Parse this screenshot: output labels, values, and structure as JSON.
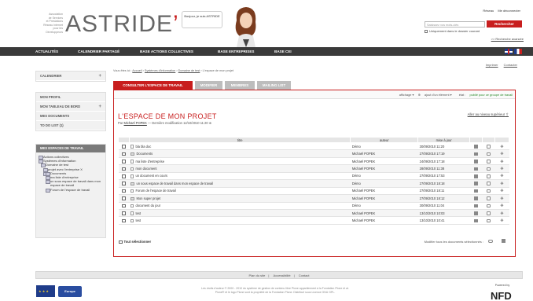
{
  "header": {
    "logo_small_lines": [
      "Association",
      "de Services",
      "et Prestations",
      "Réseau Internet",
      "pour les",
      "Développeurs"
    ],
    "logo_text": "ASTRIDE",
    "bubble_text": "Bonjour, je suis ASTRIDE",
    "links": [
      "Réseau",
      "Me déconnecter"
    ],
    "search_placeholder": "Saisissez vos mots-clés",
    "search_button": "Rechercher",
    "search_checkbox_label": "Uniquement dans le dossier courant",
    "advanced_search": ">> Recherche avancée"
  },
  "topnav": {
    "items": [
      "ACTUALITÉS",
      "CALENDRIER PARTAGÉ",
      "BASE ACTIONS COLLECTIVES",
      "BASE ENTREPRISES",
      "BASE CEI"
    ]
  },
  "sidebar": {
    "top": [
      {
        "label": "CALENDRIER",
        "plus": "+"
      }
    ],
    "menu": [
      {
        "label": "MON PROFIL",
        "plus": ""
      },
      {
        "label": "MON TABLEAU DE BORD",
        "plus": "+"
      },
      {
        "label": "MES DOCUMENTS",
        "plus": ""
      },
      {
        "label": "TO DO LIST (1)",
        "plus": ""
      }
    ],
    "tree_title": "MES ESPACES DE TRAVAIL",
    "tree": [
      "Actions collectives",
      "Systèmes d'information",
      "Domaine de test",
      "projet avec l'entreprise X",
      "",
      "Documents",
      "ma liste d'entreprise",
      "un sous espace de travail dans mon espace de travail",
      "Forum de l'espace de travail"
    ]
  },
  "main": {
    "breadcrumb": [
      "Vous êtes ici :",
      "Accueil",
      "Systèmes d'information",
      "Domaine de test",
      "L'espace de mon projet"
    ],
    "tools": [
      "Imprimer",
      "Contacter"
    ],
    "tabs": [
      "CONSULTER L'ESPACE DE TRAVAIL",
      "MODIFIER",
      "MEMBRES",
      "MAILING LIST"
    ],
    "panel_actions": {
      "display": "affichage",
      "add": "ajout d'un élément",
      "state_label": "état :",
      "state_value": "publié pour ce groupe de travail"
    },
    "title": "L'ESPACE DE MON PROJET",
    "subtitle_prefix": "Par",
    "author": "Michaël POPEK",
    "subtitle_suffix": "— Dernière modification 12/10/2010 11:20",
    "up_link": "Aller au niveau supérieur",
    "columns": [
      "titre",
      "auteur",
      "mise à jour"
    ],
    "rows": [
      {
        "title": "bla bla doc",
        "author": "Démo",
        "date": "30/09/2010 11:20",
        "icon": "file"
      },
      {
        "title": "Documents",
        "author": "Michaël POPEK",
        "date": "27/09/2010 17:19",
        "icon": "folder"
      },
      {
        "title": "ma liste d'entreprise",
        "author": "Michaël POPEK",
        "date": "24/09/2010 17:18",
        "icon": "file"
      },
      {
        "title": "mon document",
        "author": "Michaël POPEK",
        "date": "28/09/2010 11:38",
        "icon": "file"
      },
      {
        "title": "un document en cours",
        "author": "Démo",
        "date": "27/09/2010 17:53",
        "icon": "file"
      },
      {
        "title": "un sous espace de travail dans mon espace de travail",
        "author": "Démo",
        "date": "27/09/2010 18:18",
        "icon": "folder"
      },
      {
        "title": "Forum de l'espace de travail",
        "author": "Michaël POPEK",
        "date": "27/09/2010 18:11",
        "icon": "file"
      },
      {
        "title": "Mon super projet",
        "author": "Michaël POPEK",
        "date": "27/09/2010 18:12",
        "icon": "folder"
      },
      {
        "title": "document du jour",
        "author": "Démo",
        "date": "30/09/2010 11:04",
        "icon": "file"
      },
      {
        "title": "test",
        "author": "Michaël POPEK",
        "date": "13/10/2010 10:03",
        "icon": "file"
      },
      {
        "title": "test",
        "author": "Michaël POPEK",
        "date": "13/10/2010 10:41",
        "icon": "file"
      }
    ],
    "select_all": "Tout sélectionner",
    "modify_all": "Modifier tous les documents sélectionnés :"
  },
  "footer": {
    "links": [
      "Plan du site",
      "Accessibilité",
      "Contact"
    ],
    "eu_label": "Europe",
    "legal_lines": [
      "Les droits d'auteur © 2000 - 2010 du système de gestion de contenu libre Plone appartiennent à la Fondation Plone et al.",
      "Plone® et le logo Plone sont la propriété de la Fondation Plone. Distribué sous Licence GNU GPL."
    ],
    "powered": "Powered by",
    "nfd_text": "NFD"
  }
}
